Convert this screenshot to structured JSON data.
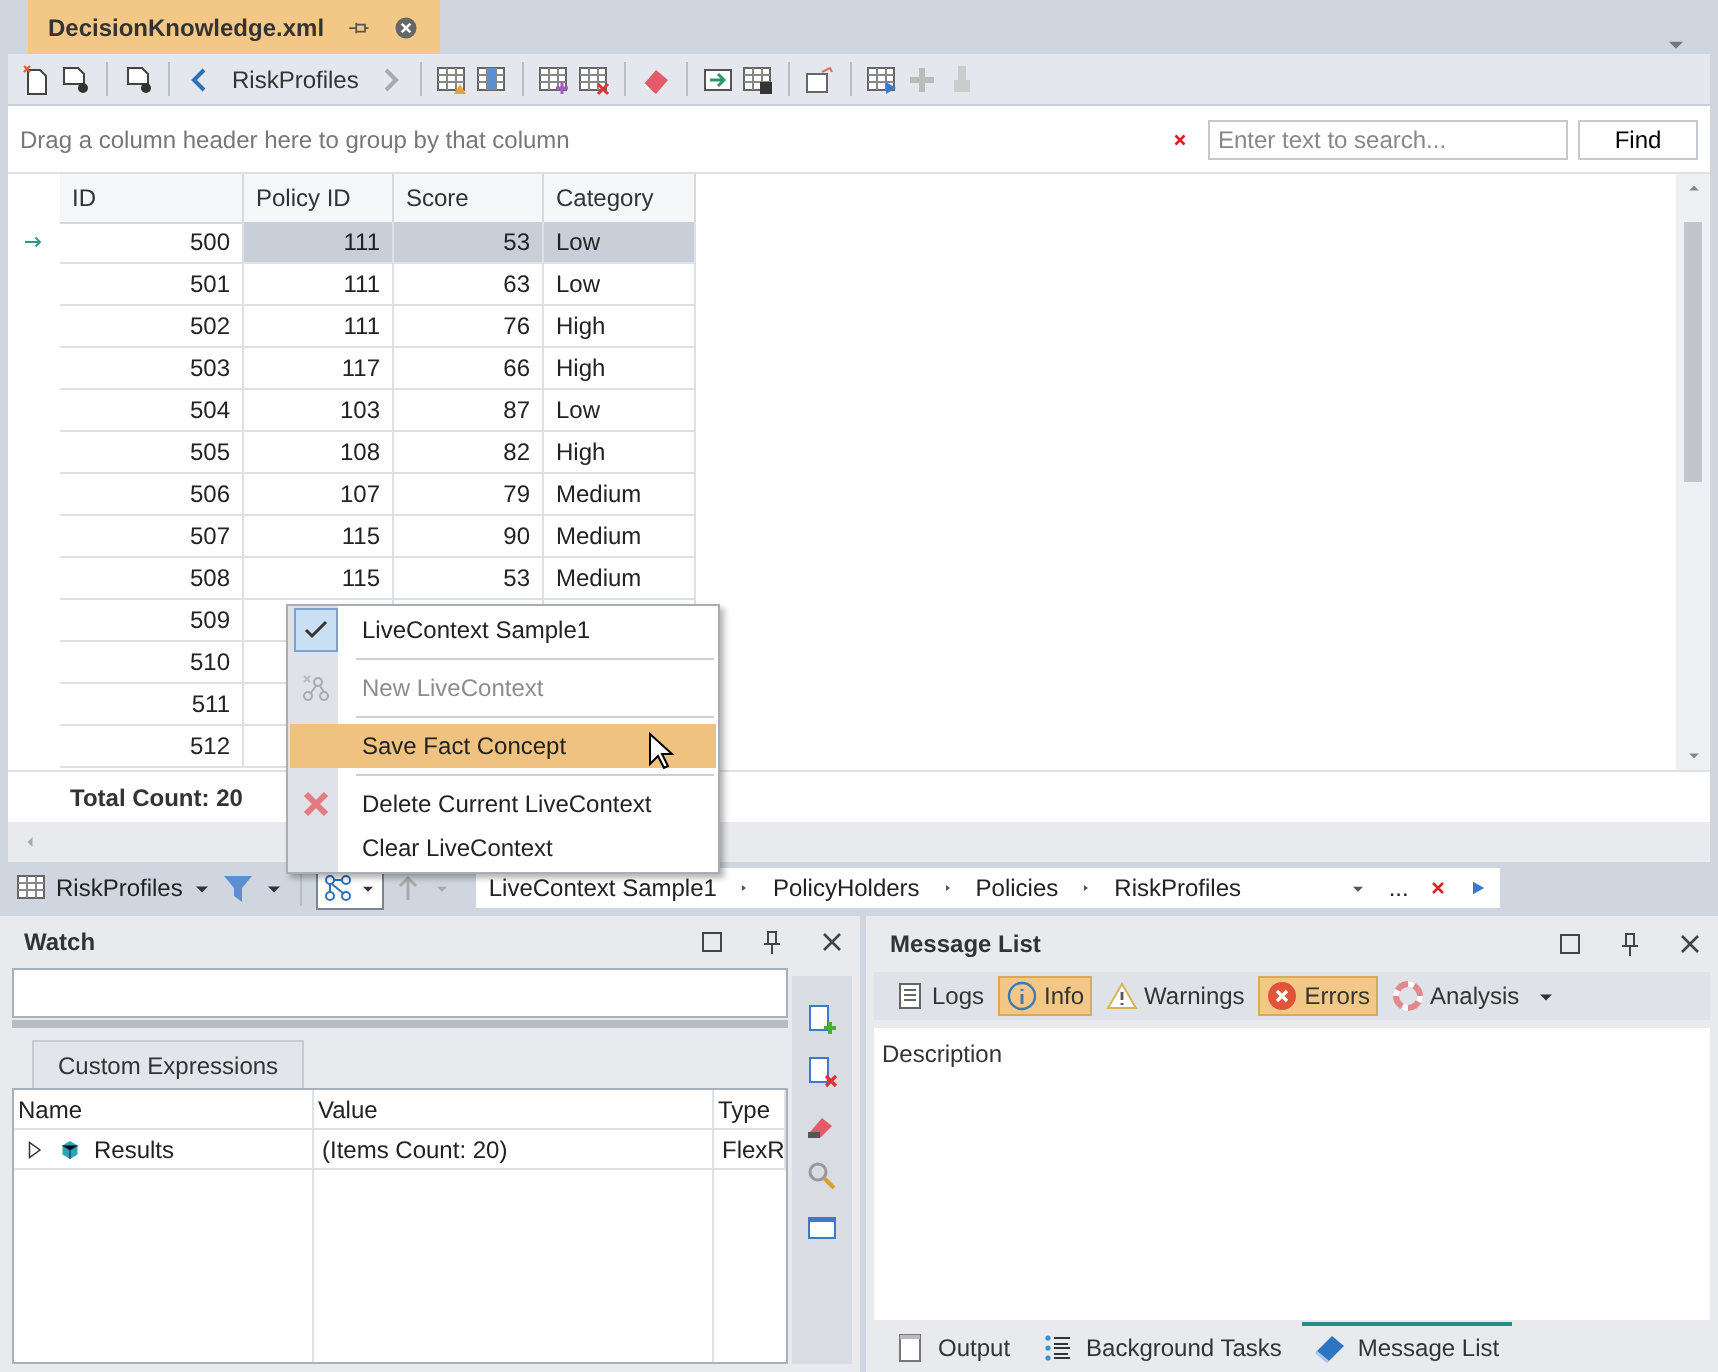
{
  "document_tab": {
    "title": "DecisionKnowledge.xml"
  },
  "toolbar": {
    "nav_label": "RiskProfiles"
  },
  "group_panel": {
    "hint": "Drag a column header here to group by that column",
    "search": {
      "placeholder": "Enter text to search..."
    },
    "find_button": "Find"
  },
  "grid": {
    "columns": [
      "ID",
      "Policy ID",
      "Score",
      "Category"
    ],
    "rows": [
      {
        "cells": [
          "500",
          "111",
          "53",
          "Low"
        ],
        "selected": true
      },
      {
        "cells": [
          "501",
          "111",
          "63",
          "Low"
        ],
        "selected": false
      },
      {
        "cells": [
          "502",
          "111",
          "76",
          "High"
        ],
        "selected": false
      },
      {
        "cells": [
          "503",
          "117",
          "66",
          "High"
        ],
        "selected": false
      },
      {
        "cells": [
          "504",
          "103",
          "87",
          "Low"
        ],
        "selected": false
      },
      {
        "cells": [
          "505",
          "108",
          "82",
          "High"
        ],
        "selected": false
      },
      {
        "cells": [
          "506",
          "107",
          "79",
          "Medium"
        ],
        "selected": false
      },
      {
        "cells": [
          "507",
          "115",
          "90",
          "Medium"
        ],
        "selected": false
      },
      {
        "cells": [
          "508",
          "115",
          "53",
          "Medium"
        ],
        "selected": false
      },
      {
        "cells": [
          "509"
        ],
        "selected": false
      },
      {
        "cells": [
          "510"
        ],
        "selected": false
      },
      {
        "cells": [
          "511"
        ],
        "selected": false
      },
      {
        "cells": [
          "512"
        ],
        "selected": false
      }
    ],
    "footer": "Total Count: 20"
  },
  "nav_bar": {
    "table_label": "RiskProfiles",
    "breadcrumb": [
      "LiveContext Sample1",
      "PolicyHolders",
      "Policies",
      "RiskProfiles"
    ],
    "more": "..."
  },
  "context_menu": {
    "items": [
      {
        "label": "LiveContext Sample1",
        "kind": "check",
        "checked": true,
        "disabled": false,
        "selected": false,
        "separator_after": true
      },
      {
        "label": "New LiveContext",
        "kind": "new",
        "checked": false,
        "disabled": true,
        "selected": false,
        "separator_after": true
      },
      {
        "label": "Save Fact Concept",
        "kind": "plain",
        "checked": false,
        "disabled": false,
        "selected": true,
        "separator_after": true
      },
      {
        "label": "Delete Current LiveContext",
        "kind": "delete",
        "checked": false,
        "disabled": false,
        "selected": false,
        "separator_after": false
      },
      {
        "label": "Clear LiveContext",
        "kind": "plain",
        "checked": false,
        "disabled": false,
        "selected": false,
        "separator_after": false
      }
    ]
  },
  "watch": {
    "title": "Watch",
    "tab": "Custom Expressions",
    "columns": [
      "Name",
      "Value",
      "Type"
    ],
    "rows": [
      {
        "name": "Results",
        "value": "(Items Count: 20)",
        "type": "FlexR",
        "expanded": false
      }
    ]
  },
  "message_list": {
    "title": "Message List",
    "filters": [
      {
        "label": "Logs",
        "kind": "logs",
        "selected": false
      },
      {
        "label": "Info",
        "kind": "info",
        "selected": true
      },
      {
        "label": "Warnings",
        "kind": "warnings",
        "selected": false
      },
      {
        "label": "Errors",
        "kind": "errors",
        "selected": true
      },
      {
        "label": "Analysis",
        "kind": "analysis",
        "selected": false
      }
    ],
    "columns": [
      "Description"
    ]
  },
  "bottom_tabs": [
    {
      "label": "Output",
      "kind": "output",
      "selected": false
    },
    {
      "label": "Background Tasks",
      "kind": "tasks",
      "selected": false
    },
    {
      "label": "Message List",
      "kind": "messages",
      "selected": true
    }
  ]
}
